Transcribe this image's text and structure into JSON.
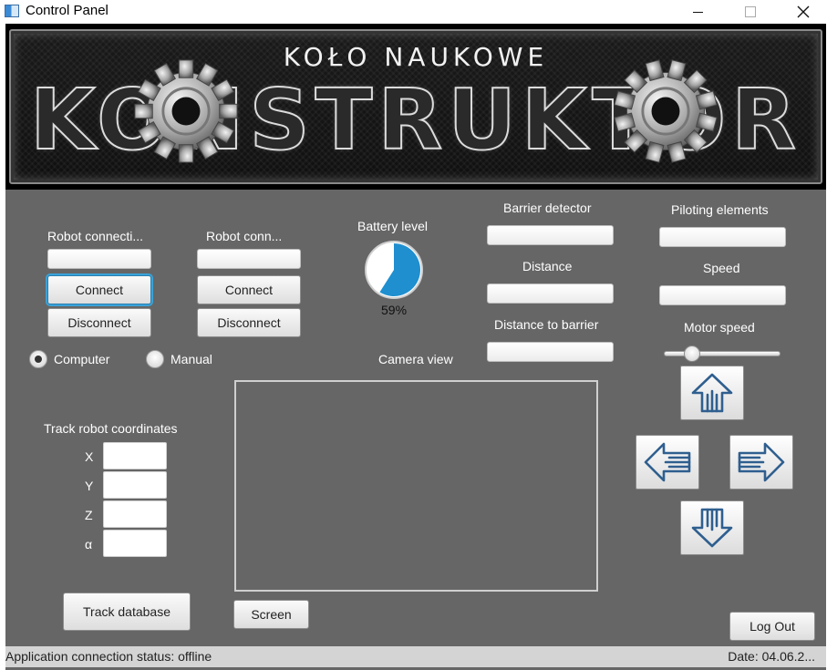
{
  "window": {
    "title": "Control Panel"
  },
  "banner": {
    "subtitle": "KOŁO NAUKOWE",
    "title": "KONSTRUKTOR"
  },
  "connection1": {
    "label": "Robot connecti...",
    "value": "",
    "connect_label": "Connect",
    "disconnect_label": "Disconnect"
  },
  "connection2": {
    "label": "Robot conn...",
    "value": "",
    "connect_label": "Connect",
    "disconnect_label": "Disconnect"
  },
  "battery": {
    "label": "Battery level",
    "level": 0.59,
    "text": "59%",
    "fill_color": "#1f8fcf"
  },
  "sensors": {
    "barrier_label": "Barrier detector",
    "barrier_value": "",
    "distance_label": "Distance",
    "distance_value": "",
    "distance_barrier_label": "Distance to barrier",
    "distance_barrier_value": ""
  },
  "piloting": {
    "elements_label": "Piloting elements",
    "elements_value": "",
    "speed_label": "Speed",
    "speed_value": "",
    "motor_speed_label": "Motor speed",
    "motor_speed_level": 0.2
  },
  "mode": {
    "options": [
      "Computer",
      "Manual"
    ],
    "selected": "Computer"
  },
  "camera": {
    "label": "Camera view",
    "screen_button": "Screen"
  },
  "tracking": {
    "label": "Track robot coordinates",
    "coords": [
      {
        "label": "X",
        "value": ""
      },
      {
        "label": "Y",
        "value": ""
      },
      {
        "label": "Z",
        "value": ""
      },
      {
        "label": "α",
        "value": ""
      }
    ],
    "database_button": "Track database"
  },
  "controls": {
    "icons": [
      "arrow-up-icon",
      "arrow-left-icon",
      "arrow-right-icon",
      "arrow-down-icon"
    ],
    "icon_color": "#2f5f8f"
  },
  "logout_label": "Log Out",
  "status": {
    "connection": "Application connection status: offline",
    "date": "Date: 04.06.2..."
  }
}
